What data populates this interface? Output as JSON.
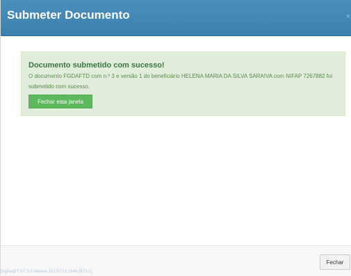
{
  "modal": {
    "title": "Submeter Documento",
    "close_glyph": "×"
  },
  "alert": {
    "heading": "Documento submetido com sucesso!",
    "message": "O documento FGDAFTD com n.º 3 e versão 1 do beneficiário HELENA MARIA DA SILVA SARAIVA com NIFAP 7267882 foi submetido com sucesso.",
    "close_window_label": "Fechar esta janela"
  },
  "footer": {
    "close_label": "Fechar",
    "version_text": "Digital@T.IvT 3.3 release 20170713.1646 (873-2)"
  },
  "colors": {
    "header_blue": "#3b7fae",
    "success_green": "#5cb85c",
    "alert_bg": "#e0eedb"
  }
}
